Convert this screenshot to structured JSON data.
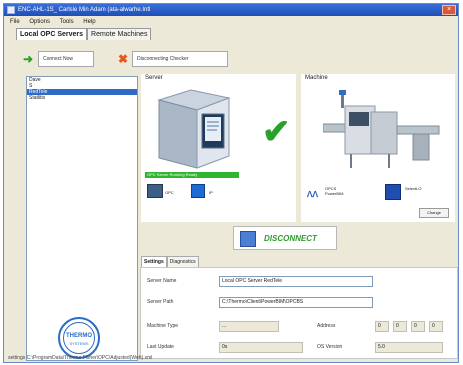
{
  "window": {
    "title": "ENC-AHL-1S_ Carlsle Min Adam (ata-alwarhe.Intl"
  },
  "menu": [
    "File",
    "Options",
    "Tools",
    "Help"
  ],
  "tabs": [
    {
      "label": "Local OPC Servers",
      "active": true
    },
    {
      "label": "Remote Machines",
      "active": false
    }
  ],
  "toolbar": {
    "connect_label": "Connect Now",
    "disconnect_label": "Disconnecting Checker"
  },
  "servers": [
    {
      "label": "Dave",
      "selected": false
    },
    {
      "label": "S",
      "selected": false
    },
    {
      "label": "RedTele",
      "selected": true
    },
    {
      "label": "Statlitis",
      "selected": false
    }
  ],
  "server_group": {
    "title": "Server",
    "status_text": "OPC Server Running Ready",
    "pc_label": "OPC",
    "net_label": "IP"
  },
  "machine_group": {
    "title": "Machine",
    "item1_label": "OPCS\nPowerBIM",
    "item2_label": "SelectLO\n",
    "change_label": "Change"
  },
  "disconnect_button": {
    "label": "DISCONNECT"
  },
  "settings_tabs": [
    {
      "label": "Settings",
      "active": true
    },
    {
      "label": "Diagnostics",
      "active": false
    }
  ],
  "settings": {
    "server_name_label": "Server Name",
    "server_name_value": "Local OPC Server RedTele",
    "server_path_label": "Server Path",
    "server_path_value": "C:\\Thermo\\Client\\PowerBIM\\OPCBS",
    "machine_type_label": "Machine Type",
    "machine_type_value": "...",
    "address_label": "Address",
    "address_values": [
      "0",
      "0",
      "0",
      "0"
    ],
    "last_update_label": "Last Update",
    "last_update_value": "0s",
    "version_label": "OS Version",
    "version_value": "5.0"
  },
  "logo": {
    "text": "THERMO",
    "subtext": "SYSTEMS"
  },
  "status_bar": {
    "text": "settings C:\\ProgramData\\Thermo Fisher\\OPC\\Adjusted(Web).xml"
  },
  "colors": {
    "titlebar": "#2456c4",
    "selection": "#316ac5",
    "ok_green": "#2fb52f",
    "disconnect_green": "#2f9b2f",
    "window_bg": "#ece9d8"
  }
}
